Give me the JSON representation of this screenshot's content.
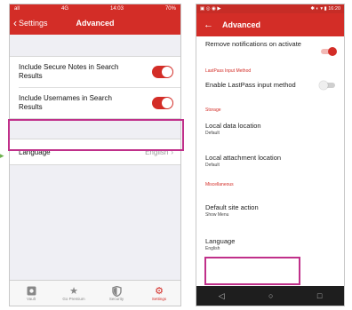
{
  "ios": {
    "status": {
      "signal": "all",
      "carrier": "4G",
      "time": "14:03",
      "battery": "70%"
    },
    "nav": {
      "back_label": "Settings",
      "title": "Advanced"
    },
    "rows": [
      {
        "label": "Include Secure Notes in Search Results",
        "on": true
      },
      {
        "label": "Include Usernames in Search Results",
        "on": true
      }
    ],
    "language": {
      "label": "Language",
      "value": "English"
    },
    "tabs": [
      {
        "label": "Vault",
        "icon": "vault-icon"
      },
      {
        "label": "Go Premium",
        "icon": "star-icon"
      },
      {
        "label": "Security",
        "icon": "shield-icon"
      },
      {
        "label": "Settings",
        "icon": "gear-icon",
        "active": true
      }
    ]
  },
  "android": {
    "status": {
      "time": "16:20"
    },
    "bar": {
      "title": "Advanced"
    },
    "remove_notifications": "Remove notifications on activate",
    "input_method_category": "LastPass Input Method",
    "input_method": "Enable LastPass input method",
    "storage_category": "Storage",
    "local_data": {
      "title": "Local data location",
      "value": "Default"
    },
    "local_attachment": {
      "title": "Local attachment location",
      "value": "Default"
    },
    "misc_category": "Miscellaneous",
    "default_site": {
      "title": "Default site action",
      "value": "Show Menu"
    },
    "language": {
      "title": "Language",
      "value": "English"
    }
  },
  "colors": {
    "accent": "#d32d27",
    "highlight": "#c0308a"
  }
}
